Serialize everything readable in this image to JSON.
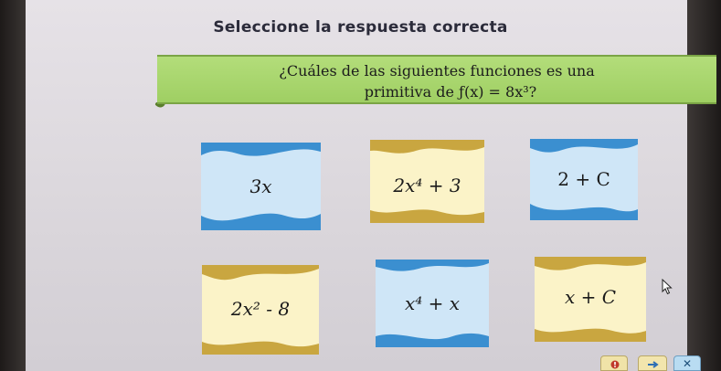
{
  "title": "Seleccione la respuesta correcta",
  "question": {
    "line1": "¿Cuáles de las siguientes funciones es una",
    "line2": "primitiva de ƒ(x) = 8x³?"
  },
  "options": [
    {
      "label": "3x"
    },
    {
      "label": "2x⁴ + 3"
    },
    {
      "label": "2 + C"
    },
    {
      "label": "2x² - 8"
    },
    {
      "label": "x⁴ + x"
    },
    {
      "label": "x + C"
    }
  ],
  "nav": {
    "close_label": "✕"
  },
  "colors": {
    "question_bg": "#a8d66c",
    "card_blue": "#cfe6f7",
    "card_blue_wave": "#3b8fd0",
    "card_yellow": "#fbf3c8",
    "card_yellow_wave": "#d7b43a"
  }
}
